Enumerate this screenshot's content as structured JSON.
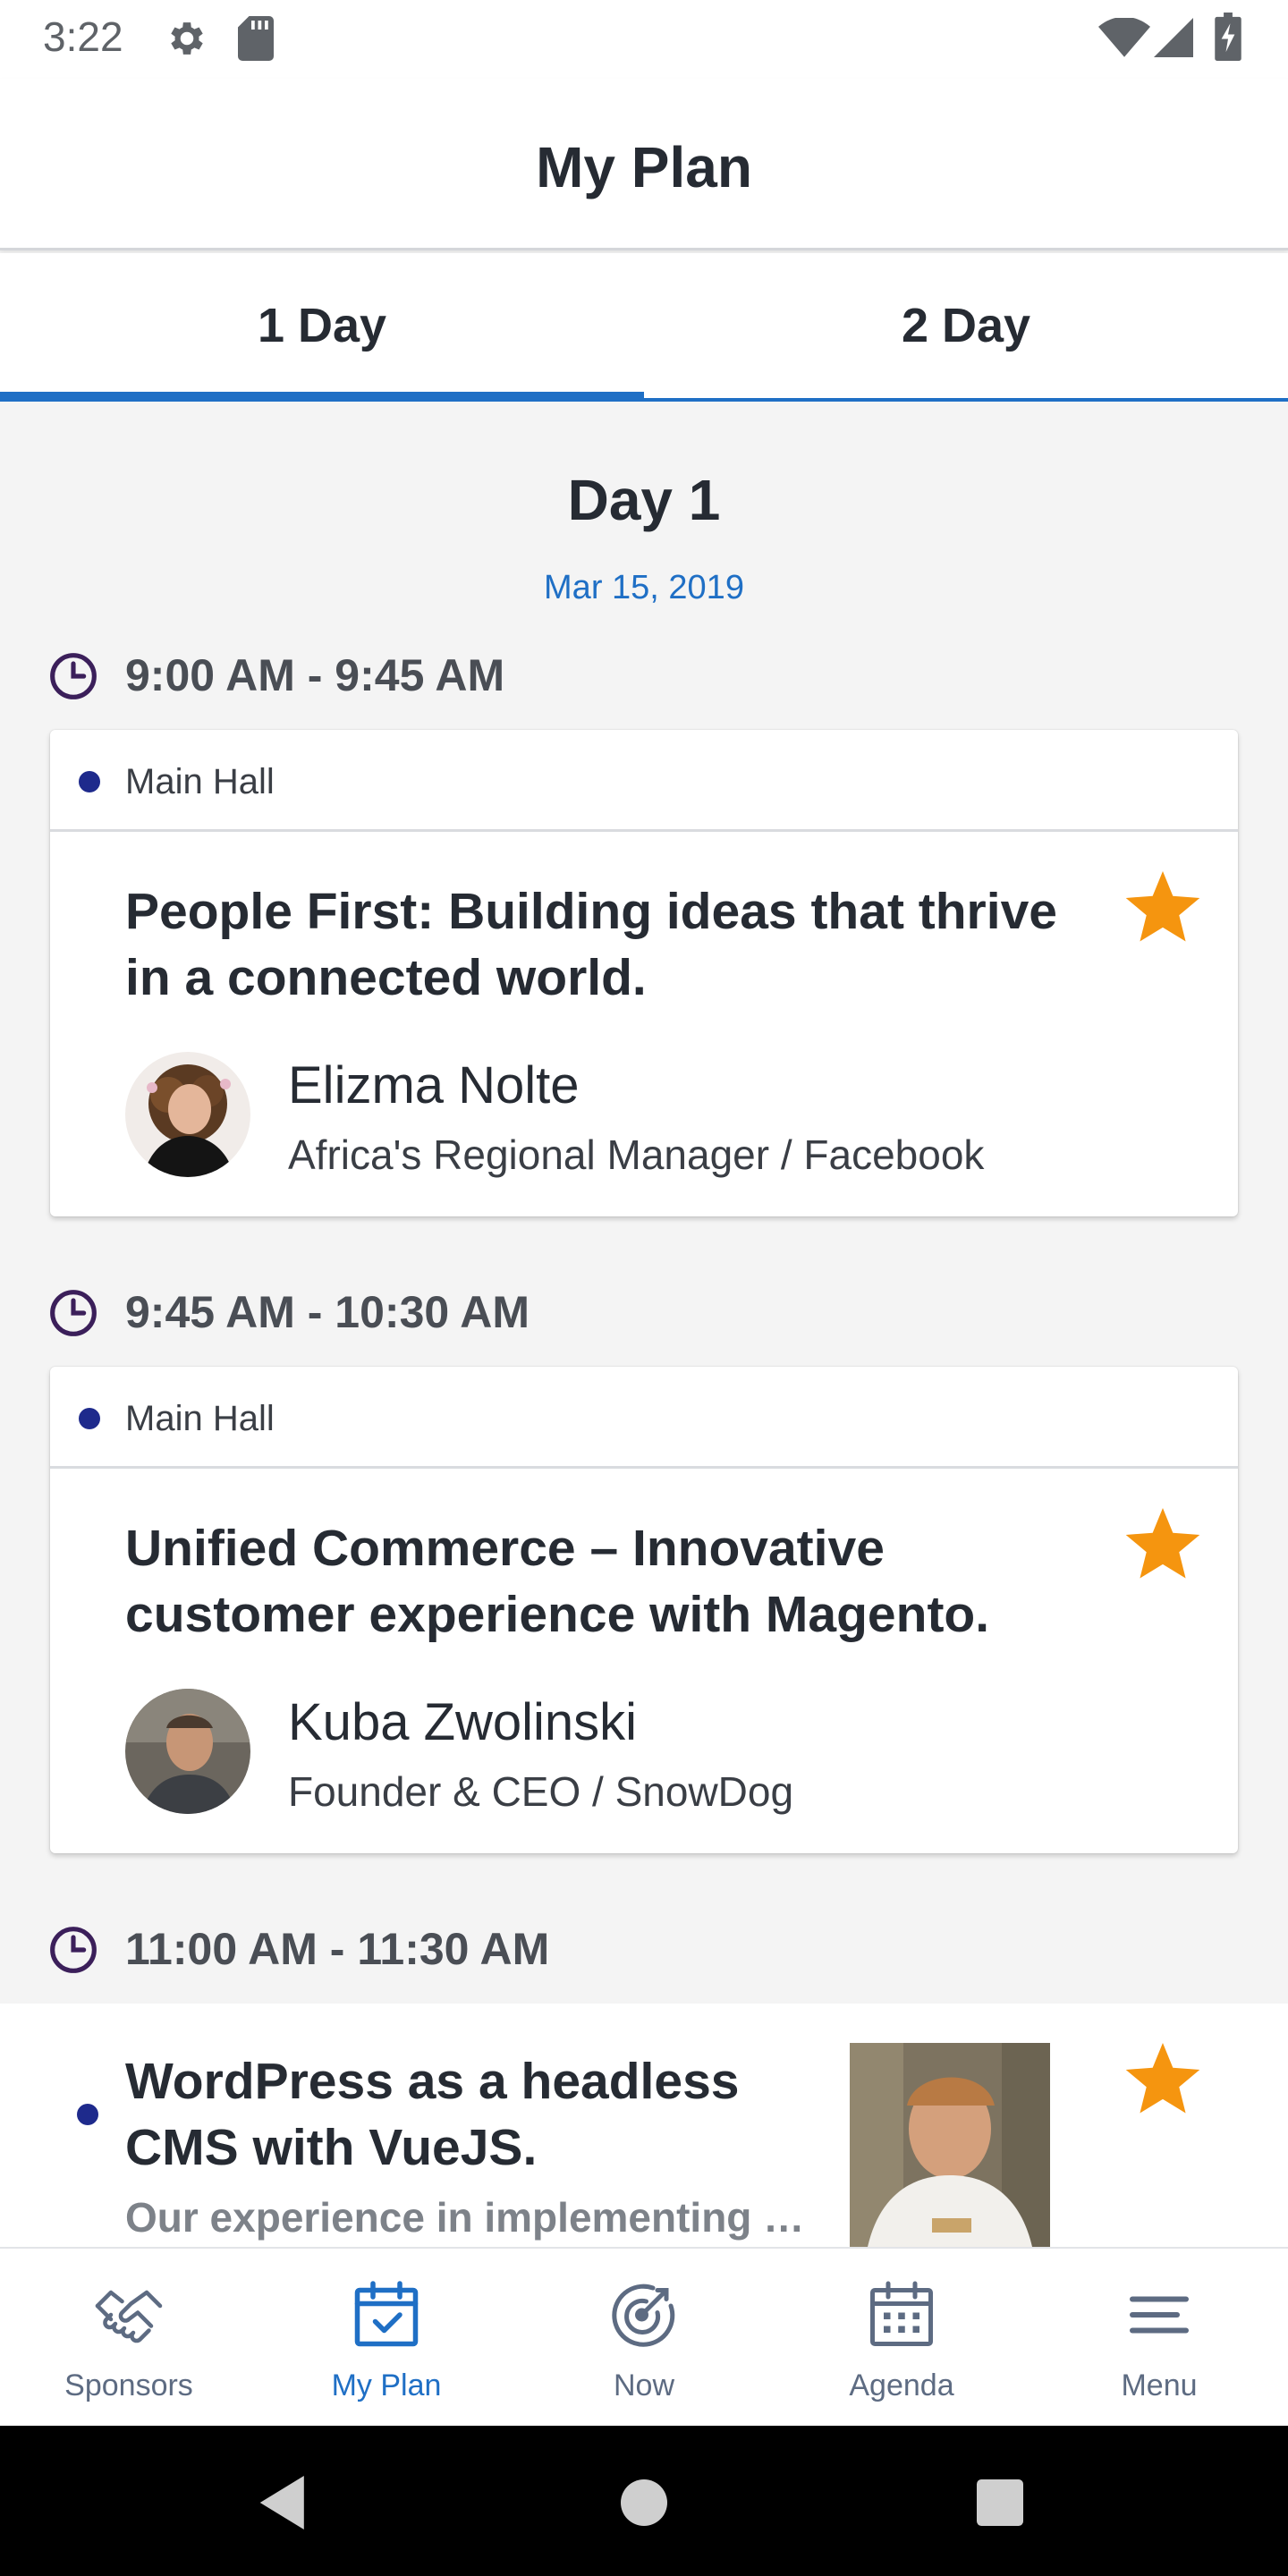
{
  "status_bar": {
    "time": "3:22",
    "left_icons": [
      "gear-icon",
      "sd-card-icon"
    ],
    "right_icons": [
      "wifi-icon",
      "cell-signal-icon",
      "battery-icon"
    ]
  },
  "header": {
    "title": "My Plan"
  },
  "tabs": [
    {
      "label": "1 Day",
      "active": true
    },
    {
      "label": "2 Day",
      "active": false
    }
  ],
  "day": {
    "title": "Day 1",
    "date": "Mar 15, 2019"
  },
  "sessions": [
    {
      "time": "9:00 AM - 9:45 AM",
      "location": "Main Hall",
      "title": "People First: Building ideas that thrive in a connected world.",
      "starred": true,
      "speaker": {
        "name": "Elizma Nolte",
        "role": "Africa's Regional Manager / Facebook"
      }
    },
    {
      "time": "9:45 AM - 10:30 AM",
      "location": "Main Hall",
      "title": "Unified Commerce – Innovative customer experience with Magento.",
      "starred": true,
      "speaker": {
        "name": "Kuba Zwolinski",
        "role": "Founder & CEO / SnowDog"
      }
    },
    {
      "time": "11:00 AM - 11:30 AM",
      "title": "WordPress as a headless CMS with VueJS.",
      "description": "Our experience in implementing W...",
      "starred": true
    }
  ],
  "bottom_nav": [
    {
      "label": "Sponsors",
      "icon": "handshake-icon",
      "active": false
    },
    {
      "label": "My Plan",
      "icon": "calendar-check-icon",
      "active": true
    },
    {
      "label": "Now",
      "icon": "target-icon",
      "active": false
    },
    {
      "label": "Agenda",
      "icon": "calendar-grid-icon",
      "active": false
    },
    {
      "label": "Menu",
      "icon": "menu-icon",
      "active": false
    }
  ],
  "colors": {
    "accent": "#1f6fc5",
    "star": "#f5950f",
    "location_dot": "#1e2a8c",
    "clock": "#3b1f5a",
    "nav_icon": "#5d6b82"
  }
}
